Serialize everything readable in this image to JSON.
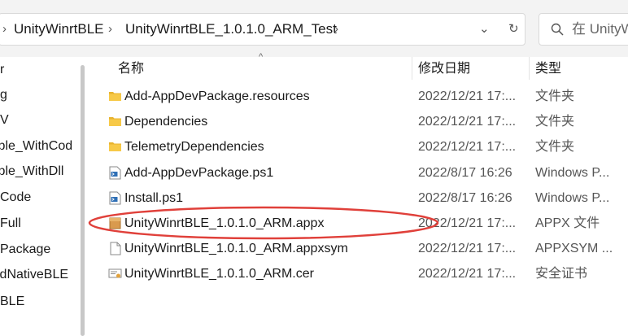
{
  "breadcrumbs": [
    "UnityWinrtBLE",
    "UnityWinrtBLE_1.0.1.0_ARM_Test"
  ],
  "search": {
    "placeholder": "在 UnityW"
  },
  "nav": {
    "items": [
      "r",
      "g",
      "V",
      "iple_WithCod",
      "iple_WithDll",
      "Code",
      "Full",
      "Package",
      "idNativeBLE",
      "BLE"
    ]
  },
  "columns": {
    "name": "名称",
    "date": "修改日期",
    "type": "类型"
  },
  "files": [
    {
      "name": "Add-AppDevPackage.resources",
      "date": "2022/12/21 17:...",
      "type": "文件夹",
      "icon": "folder-icon"
    },
    {
      "name": "Dependencies",
      "date": "2022/12/21 17:...",
      "type": "文件夹",
      "icon": "folder-icon"
    },
    {
      "name": "TelemetryDependencies",
      "date": "2022/12/21 17:...",
      "type": "文件夹",
      "icon": "folder-icon"
    },
    {
      "name": "Add-AppDevPackage.ps1",
      "date": "2022/8/17 16:26",
      "type": "Windows P...",
      "icon": "powershell-script-icon"
    },
    {
      "name": "Install.ps1",
      "date": "2022/8/17 16:26",
      "type": "Windows P...",
      "icon": "powershell-script-icon"
    },
    {
      "name": "UnityWinrtBLE_1.0.1.0_ARM.appx",
      "date": "2022/12/21 17:...",
      "type": "APPX 文件",
      "icon": "appx-package-icon"
    },
    {
      "name": "UnityWinrtBLE_1.0.1.0_ARM.appxsym",
      "date": "2022/12/21 17:...",
      "type": "APPXSYM ...",
      "icon": "generic-file-icon"
    },
    {
      "name": "UnityWinrtBLE_1.0.1.0_ARM.cer",
      "date": "2022/12/21 17:...",
      "type": "安全证书",
      "icon": "certificate-icon"
    }
  ],
  "colors": {
    "folder": "#f5c542",
    "annotation": "#e0403a",
    "header_bg": "#f3f3f3"
  }
}
